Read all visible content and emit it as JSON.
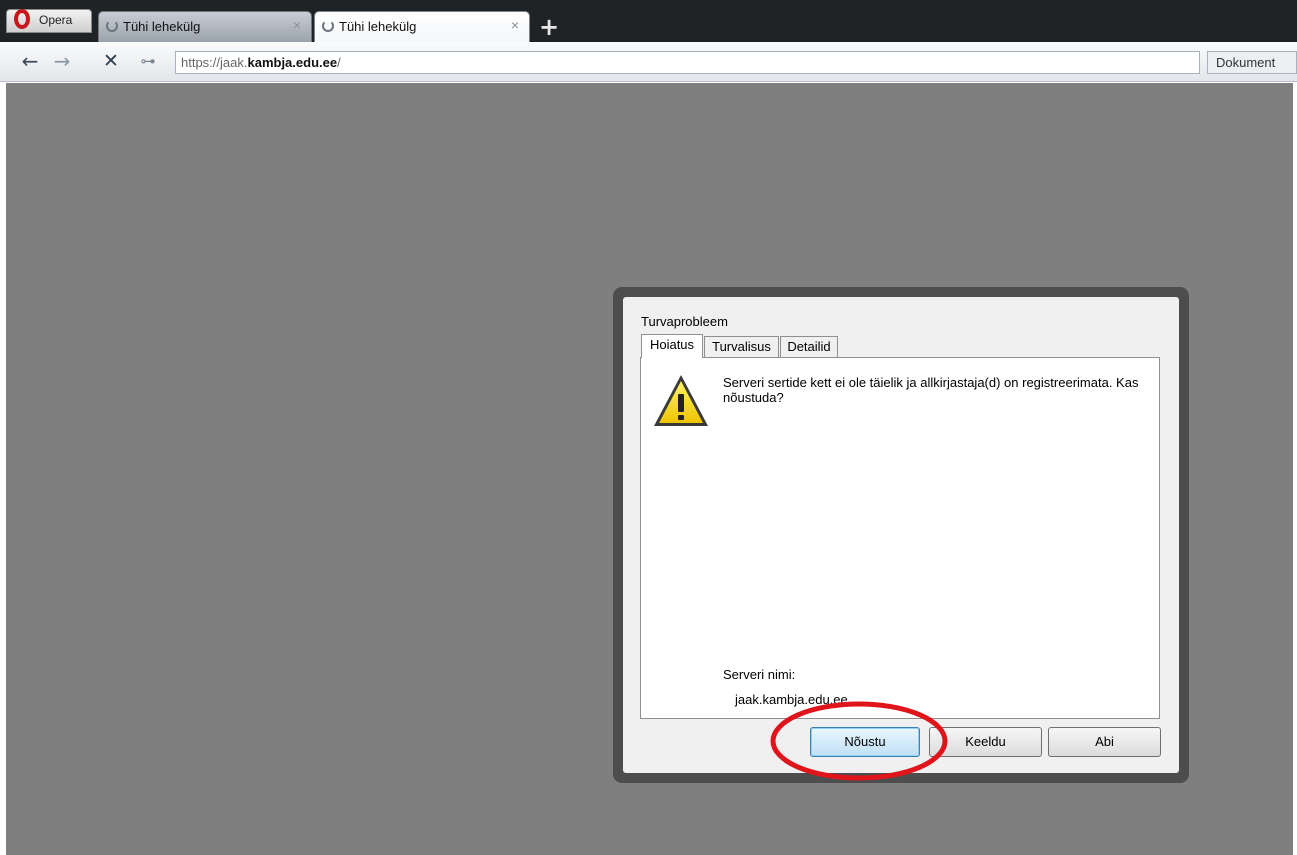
{
  "browser": {
    "menu_label": "Opera",
    "tabs": [
      {
        "label": "Tühi lehekülg",
        "close": "×",
        "active": false
      },
      {
        "label": "Tühi lehekülg",
        "close": "×",
        "active": true
      }
    ],
    "new_tab_symbol": "+",
    "nav": {
      "back_symbol": "←",
      "forward_symbol": "→",
      "stop_symbol": "✕",
      "security_symbol": "⊶"
    },
    "address": {
      "prefix": "https://jaak.",
      "host": "kambja.edu.ee",
      "suffix": "/"
    },
    "search_label": "Dokument"
  },
  "dialog": {
    "title": "Turvaprobleem",
    "tabs": [
      "Hoiatus",
      "Turvalisus",
      "Detailid"
    ],
    "active_tab": "Hoiatus",
    "icon": "warning-icon",
    "message": "Serveri sertide kett ei ole täielik ja allkirjastaja(d) on registreerimata. Kas nõustuda?",
    "server_label": "Serveri nimi:",
    "server_value": "jaak.kambja.edu.ee",
    "buttons": {
      "accept": "Nõustu",
      "decline": "Keeldu",
      "help": "Abi"
    }
  },
  "colors": {
    "page_background": "#7f7f7f",
    "annotation": "#e0141b"
  }
}
